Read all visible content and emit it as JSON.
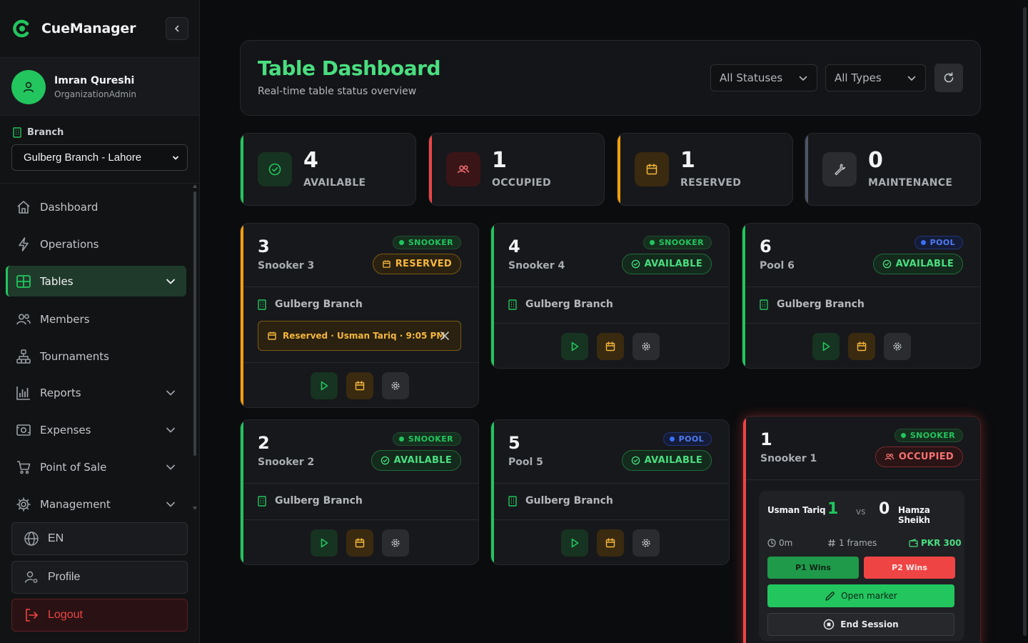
{
  "app": {
    "name": "CueManager",
    "accent": "#22c55e"
  },
  "user": {
    "name": "Imran Qureshi",
    "role": "OrganizationAdmin"
  },
  "branch": {
    "label": "Branch",
    "selected": "Gulberg Branch - Lahore"
  },
  "nav": {
    "items": [
      {
        "label": "Dashboard",
        "icon": "home-icon"
      },
      {
        "label": "Operations",
        "icon": "lightning-icon"
      },
      {
        "label": "Tables",
        "icon": "grid-icon",
        "active": true
      },
      {
        "label": "Members",
        "icon": "users-icon"
      },
      {
        "label": "Tournaments",
        "icon": "bracket-icon"
      },
      {
        "label": "Reports",
        "icon": "bar-chart-icon"
      },
      {
        "label": "Expenses",
        "icon": "money-icon"
      },
      {
        "label": "Point of Sale",
        "icon": "cart-icon"
      },
      {
        "label": "Management",
        "icon": "gear-icon"
      }
    ]
  },
  "sidebar_footer": {
    "language": "EN",
    "profile": "Profile",
    "logout": "Logout"
  },
  "header": {
    "title": "Table Dashboard",
    "subtitle": "Real-time table status overview",
    "status_filter": "All Statuses",
    "type_filter": "All Types"
  },
  "stats": [
    {
      "count": "4",
      "label": "AVAILABLE",
      "color": "#22c55e"
    },
    {
      "count": "1",
      "label": "OCCUPIED",
      "color": "#ef4444"
    },
    {
      "count": "1",
      "label": "RESERVED",
      "color": "#f59e0b"
    },
    {
      "count": "0",
      "label": "MAINTENANCE",
      "color": "#6b7280"
    }
  ],
  "tables": [
    {
      "number": "3",
      "name": "Snooker 3",
      "type": "SNOOKER",
      "status": "RESERVED",
      "branch": "Gulberg Branch",
      "reservation": "Reserved · Usman Tariq · 9:05 PM"
    },
    {
      "number": "4",
      "name": "Snooker 4",
      "type": "SNOOKER",
      "status": "AVAILABLE",
      "branch": "Gulberg Branch"
    },
    {
      "number": "6",
      "name": "Pool 6",
      "type": "POOL",
      "status": "AVAILABLE",
      "branch": "Gulberg Branch"
    },
    {
      "number": "2",
      "name": "Snooker 2",
      "type": "SNOOKER",
      "status": "AVAILABLE",
      "branch": "Gulberg Branch"
    },
    {
      "number": "5",
      "name": "Pool 5",
      "type": "POOL",
      "status": "AVAILABLE",
      "branch": "Gulberg Branch"
    },
    {
      "number": "1",
      "name": "Snooker 1",
      "type": "SNOOKER",
      "status": "OCCUPIED",
      "branch": "Gulberg Branch"
    }
  ],
  "session": {
    "player1": "Usman Tariq",
    "player1_score": "1",
    "vs": "vs",
    "player2": "Hamza Sheikh",
    "player2_score": "0",
    "duration": "0m",
    "frames": "1 frames",
    "amount": "PKR 300",
    "p1_wins_label": "P1 Wins",
    "p2_wins_label": "P2 Wins",
    "open_marker_label": "Open marker",
    "end_session_label": "End Session"
  }
}
